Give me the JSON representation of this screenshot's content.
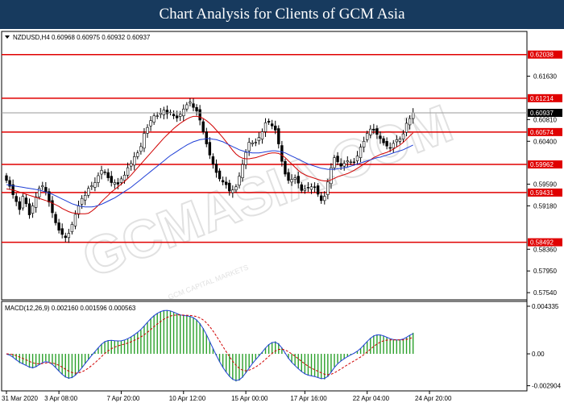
{
  "banner": {
    "title": "Chart Analysis for Clients of GCM Asia"
  },
  "watermark": {
    "text": "GCMASIA.COM",
    "subtext": "GCM CAPITAL MARKETS"
  },
  "chart_data": [
    {
      "type": "candlestick",
      "header": "NZDUSD,H4  0.60968 0.60975 0.60932 0.60937",
      "symbol": "NZDUSD,H4",
      "ohlc_last": {
        "open": 0.60968,
        "high": 0.60975,
        "low": 0.60932,
        "close": 0.60937
      },
      "current_price": 0.60937,
      "ylim": [
        0.5742,
        0.6246
      ],
      "y_ticks": [
        0.6163,
        0.6081,
        0.604,
        0.5959,
        0.5918,
        0.5836,
        0.5795,
        0.5754
      ],
      "x_ticks": [
        "31 Mar 2020",
        "3 Apr 08:00",
        "7 Apr 20:00",
        "10 Apr 12:00",
        "15 Apr 00:00",
        "17 Apr 16:00",
        "22 Apr 04:00",
        "24 Apr 20:00"
      ],
      "x_tick_index": [
        0,
        16,
        35,
        54,
        73,
        91,
        110,
        129
      ],
      "levels": [
        0.62038,
        0.61214,
        0.60574,
        0.59962,
        0.59431,
        0.58492
      ],
      "close": [
        0.5966,
        0.5955,
        0.5939,
        0.5926,
        0.5911,
        0.5936,
        0.5922,
        0.5901,
        0.5918,
        0.5935,
        0.5951,
        0.5956,
        0.5945,
        0.5925,
        0.5905,
        0.5886,
        0.5872,
        0.5864,
        0.5858,
        0.5866,
        0.5883,
        0.5902,
        0.5918,
        0.5932,
        0.5938,
        0.5951,
        0.5956,
        0.5962,
        0.5975,
        0.5985,
        0.5981,
        0.5971,
        0.5962,
        0.5962,
        0.5959,
        0.5969,
        0.5976,
        0.599,
        0.5998,
        0.6011,
        0.6018,
        0.603,
        0.6055,
        0.6066,
        0.6079,
        0.6088,
        0.6088,
        0.6093,
        0.6099,
        0.6092,
        0.6094,
        0.6088,
        0.6084,
        0.6091,
        0.6101,
        0.6109,
        0.6114,
        0.6104,
        0.6097,
        0.608,
        0.6058,
        0.6035,
        0.6014,
        0.5997,
        0.5981,
        0.5969,
        0.5963,
        0.5958,
        0.5946,
        0.5948,
        0.5954,
        0.5974,
        0.5996,
        0.6019,
        0.6038,
        0.6037,
        0.6038,
        0.6047,
        0.6058,
        0.6075,
        0.6076,
        0.6069,
        0.6061,
        0.6035,
        0.6002,
        0.5978,
        0.5966,
        0.5968,
        0.5971,
        0.5961,
        0.5947,
        0.595,
        0.5952,
        0.5954,
        0.5953,
        0.594,
        0.5928,
        0.5936,
        0.5963,
        0.599,
        0.6009,
        0.6001,
        0.5993,
        0.5998,
        0.6003,
        0.6001,
        0.6,
        0.6012,
        0.6029,
        0.604,
        0.6055,
        0.6063,
        0.6061,
        0.6053,
        0.6045,
        0.6037,
        0.6031,
        0.6027,
        0.6036,
        0.6043,
        0.6044,
        0.6054,
        0.6074,
        0.6083,
        0.6094
      ],
      "ma_red": [
        0.595,
        0.5949,
        0.5948,
        0.5946,
        0.5944,
        0.5942,
        0.594,
        0.5938,
        0.5936,
        0.5934,
        0.5932,
        0.593,
        0.5928,
        0.5926,
        0.5923,
        0.592,
        0.5917,
        0.5913,
        0.591,
        0.5907,
        0.5905,
        0.5904,
        0.5903,
        0.5903,
        0.5903,
        0.5904,
        0.5908,
        0.5913,
        0.5919,
        0.5926,
        0.5932,
        0.5938,
        0.5944,
        0.5949,
        0.5954,
        0.5959,
        0.5964,
        0.597,
        0.5976,
        0.5983,
        0.599,
        0.5997,
        0.6004,
        0.6011,
        0.6018,
        0.6025,
        0.6032,
        0.6039,
        0.6046,
        0.6052,
        0.6058,
        0.6064,
        0.6069,
        0.6074,
        0.6078,
        0.6082,
        0.6085,
        0.6087,
        0.6087,
        0.6086,
        0.6083,
        0.6079,
        0.6074,
        0.6068,
        0.6061,
        0.6054,
        0.6047,
        0.6039,
        0.6031,
        0.6023,
        0.6016,
        0.6011,
        0.6008,
        0.6007,
        0.6007,
        0.6008,
        0.6009,
        0.6011,
        0.6013,
        0.6015,
        0.6017,
        0.6018,
        0.6018,
        0.6017,
        0.6014,
        0.6009,
        0.6003,
        0.5997,
        0.5991,
        0.5985,
        0.598,
        0.5977,
        0.5974,
        0.5972,
        0.597,
        0.5968,
        0.5966,
        0.5965,
        0.5965,
        0.5967,
        0.597,
        0.5973,
        0.5975,
        0.5977,
        0.5979,
        0.5982,
        0.5985,
        0.5989,
        0.5993,
        0.5997,
        0.6001,
        0.6005,
        0.6009,
        0.6012,
        0.6015,
        0.6017,
        0.6019,
        0.6022,
        0.6025,
        0.6029,
        0.6033,
        0.6038,
        0.6044,
        0.605,
        0.6056
      ],
      "ma_blue": [
        0.5958,
        0.5957,
        0.5956,
        0.5955,
        0.5954,
        0.5953,
        0.5952,
        0.5951,
        0.595,
        0.5949,
        0.5948,
        0.5946,
        0.5944,
        0.5942,
        0.594,
        0.5937,
        0.5934,
        0.5931,
        0.5928,
        0.5925,
        0.5922,
        0.592,
        0.5918,
        0.5917,
        0.5916,
        0.5916,
        0.5916,
        0.5917,
        0.5919,
        0.5921,
        0.5924,
        0.5927,
        0.593,
        0.5933,
        0.5937,
        0.5941,
        0.5945,
        0.5949,
        0.5953,
        0.5958,
        0.5963,
        0.5968,
        0.5973,
        0.5978,
        0.5983,
        0.5988,
        0.5993,
        0.5998,
        0.6003,
        0.6008,
        0.6013,
        0.6017,
        0.6021,
        0.6025,
        0.6029,
        0.6033,
        0.6036,
        0.6039,
        0.6041,
        0.6043,
        0.6044,
        0.6045,
        0.6045,
        0.6044,
        0.6043,
        0.6041,
        0.6039,
        0.6036,
        0.6033,
        0.603,
        0.6027,
        0.6024,
        0.6022,
        0.602,
        0.6019,
        0.6018,
        0.6018,
        0.6018,
        0.6019,
        0.602,
        0.6021,
        0.6022,
        0.6022,
        0.6021,
        0.602,
        0.6018,
        0.6015,
        0.6012,
        0.6009,
        0.6006,
        0.6003,
        0.6,
        0.5997,
        0.5995,
        0.5993,
        0.5991,
        0.5989,
        0.5988,
        0.5987,
        0.5987,
        0.5987,
        0.5988,
        0.5989,
        0.599,
        0.5991,
        0.5993,
        0.5995,
        0.5997,
        0.5999,
        0.6001,
        0.6003,
        0.6005,
        0.6007,
        0.6009,
        0.601,
        0.6012,
        0.6014,
        0.6016,
        0.6018,
        0.602,
        0.6022,
        0.6024,
        0.6027,
        0.603,
        0.6033
      ]
    },
    {
      "type": "macd",
      "header": "MACD(12,26,9)  0.002160  0.001596  0.000563",
      "label": "MACD(12,26,9)",
      "values_shown": [
        0.00216,
        0.001596,
        0.000563
      ],
      "ylim": [
        -0.0033,
        0.0047
      ],
      "y_ticks": [
        0.004335,
        0.0,
        -0.002904
      ],
      "y_tick_labels": [
        "0.004335",
        "0.00",
        "-0.002904"
      ]
    }
  ]
}
